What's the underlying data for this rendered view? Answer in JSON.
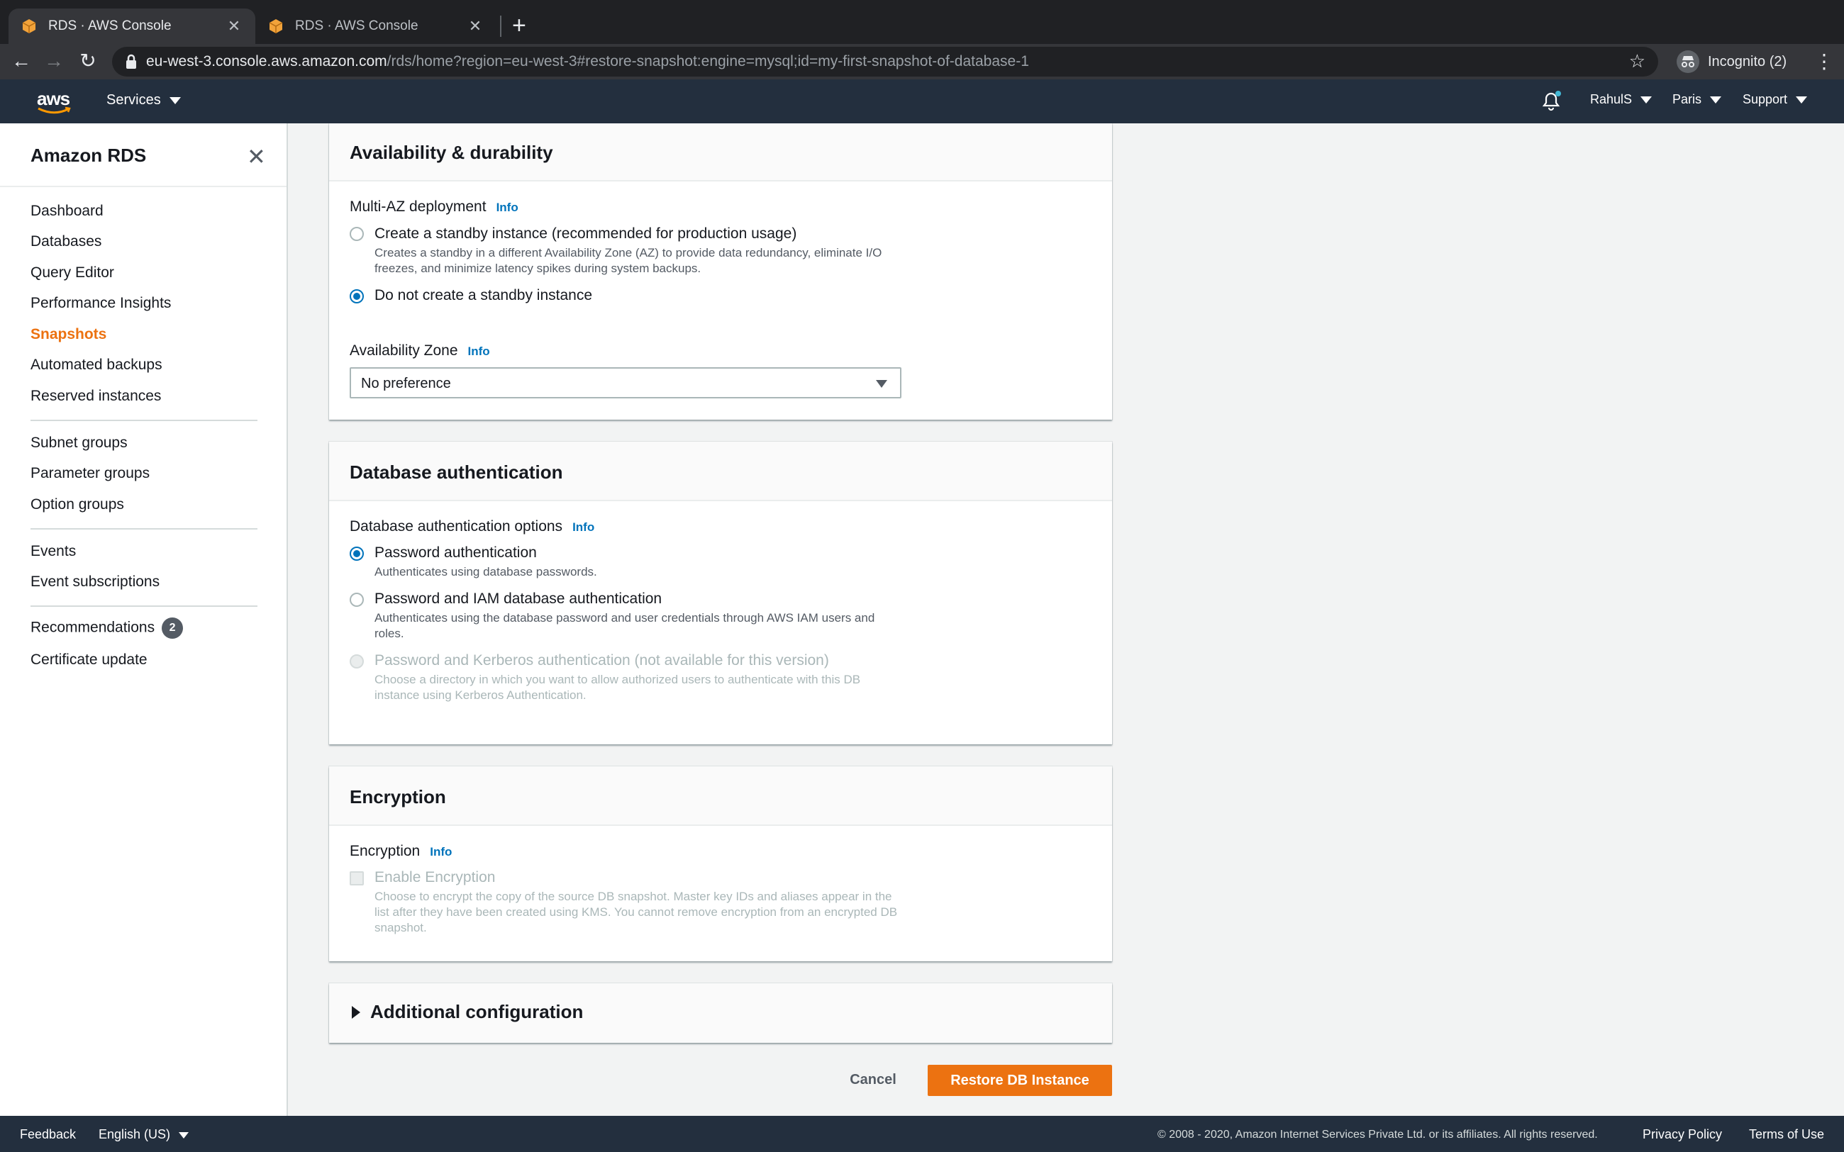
{
  "browser": {
    "tabs": [
      {
        "title": "RDS · AWS Console",
        "active": true
      },
      {
        "title": "RDS · AWS Console",
        "active": false
      }
    ],
    "url_host": "eu-west-3.console.aws.amazon.com",
    "url_path": "/rds/home?region=eu-west-3#restore-snapshot:engine=mysql;id=my-first-snapshot-of-database-1",
    "incognito_label": "Incognito (2)"
  },
  "aws_nav": {
    "logo_text": "aws",
    "services_label": "Services",
    "user_label": "RahulS",
    "region_label": "Paris",
    "support_label": "Support"
  },
  "sidebar": {
    "title": "Amazon RDS",
    "items": [
      {
        "label": "Dashboard"
      },
      {
        "label": "Databases"
      },
      {
        "label": "Query Editor"
      },
      {
        "label": "Performance Insights"
      },
      {
        "label": "Snapshots",
        "active": true
      },
      {
        "label": "Automated backups"
      },
      {
        "label": "Reserved instances"
      },
      {
        "label": "Subnet groups"
      },
      {
        "label": "Parameter groups"
      },
      {
        "label": "Option groups"
      },
      {
        "label": "Events"
      },
      {
        "label": "Event subscriptions"
      },
      {
        "label": "Recommendations",
        "badge": "2"
      },
      {
        "label": "Certificate update"
      }
    ]
  },
  "availability": {
    "title": "Availability & durability",
    "multi_az_label": "Multi-AZ deployment",
    "info": "Info",
    "opt_standby_label": "Create a standby instance (recommended for production usage)",
    "opt_standby_desc": "Creates a standby in a different Availability Zone (AZ) to provide data redundancy, eliminate I/O freezes, and minimize latency spikes during system backups.",
    "opt_no_standby_label": "Do not create a standby instance",
    "az_label": "Availability Zone",
    "az_value": "No preference"
  },
  "auth": {
    "title": "Database authentication",
    "options_label": "Database authentication options",
    "info": "Info",
    "opt_password_label": "Password authentication",
    "opt_password_desc": "Authenticates using database passwords.",
    "opt_iam_label": "Password and IAM database authentication",
    "opt_iam_desc": "Authenticates using the database password and user credentials through AWS IAM users and roles.",
    "opt_kerberos_label": "Password and Kerberos authentication (not available for this version)",
    "opt_kerberos_desc": "Choose a directory in which you want to allow authorized users to authenticate with this DB instance using Kerberos Authentication."
  },
  "encryption": {
    "title": "Encryption",
    "label": "Encryption",
    "info": "Info",
    "checkbox_label": "Enable Encryption",
    "checkbox_desc": "Choose to encrypt the copy of the source DB snapshot. Master key IDs and aliases appear in the list after they have been created using KMS. You cannot remove encryption from an encrypted DB snapshot."
  },
  "additional": {
    "title": "Additional configuration"
  },
  "actions": {
    "cancel_label": "Cancel",
    "restore_label": "Restore DB Instance"
  },
  "footer": {
    "feedback": "Feedback",
    "language": "English (US)",
    "copyright": "© 2008 - 2020, Amazon Internet Services Private Ltd. or its affiliates. All rights reserved.",
    "privacy": "Privacy Policy",
    "terms": "Terms of Use"
  },
  "colors": {
    "accent": "#ec7211",
    "link": "#0073bb",
    "nav_bg": "#232f3e"
  }
}
